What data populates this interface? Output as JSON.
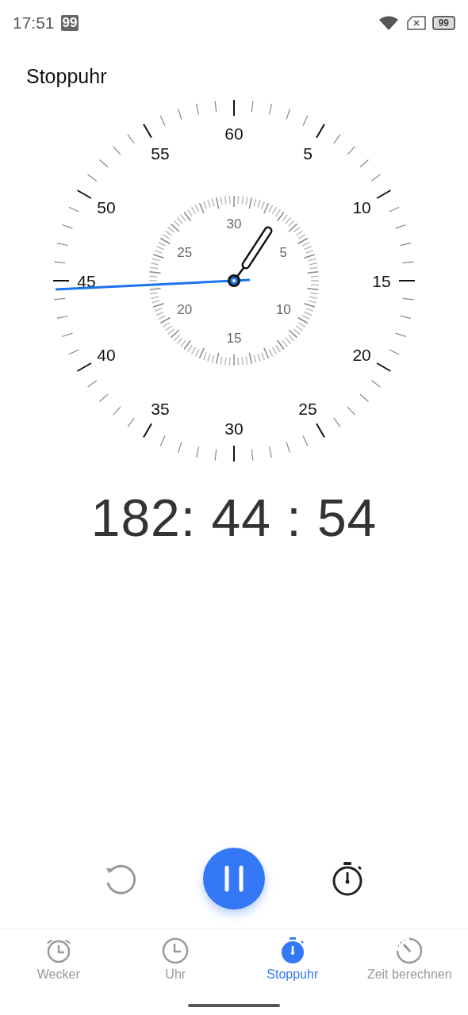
{
  "status_bar": {
    "time": "17:51",
    "badge": "99",
    "battery": "99"
  },
  "title": "Stoppuhr",
  "dial": {
    "outer_labels": [
      "60",
      "5",
      "10",
      "15",
      "20",
      "25",
      "30",
      "35",
      "40",
      "45",
      "50",
      "55"
    ],
    "inner_labels": [
      "30",
      "5",
      "10",
      "15",
      "20",
      "25"
    ]
  },
  "elapsed": "182: 44 : 54",
  "controls": {
    "running": true
  },
  "nav": [
    {
      "label": "Wecker",
      "kind": "alarm",
      "selected": false
    },
    {
      "label": "Uhr",
      "kind": "clock",
      "selected": false
    },
    {
      "label": "Stoppuhr",
      "kind": "stopwatch",
      "selected": true
    },
    {
      "label": "Zeit berechnen",
      "kind": "gauge",
      "selected": false
    }
  ]
}
